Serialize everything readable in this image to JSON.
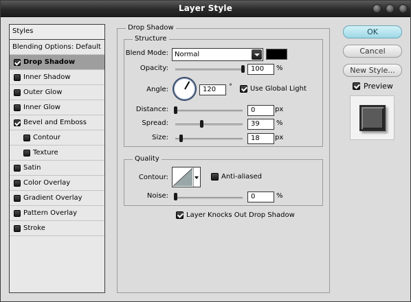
{
  "window": {
    "title": "Layer Style"
  },
  "styles_list": {
    "header": "Styles",
    "items": [
      {
        "label": "Blending Options: Default",
        "checkbox": false,
        "checked": false,
        "sub": false,
        "selected": false
      },
      {
        "label": "Drop Shadow",
        "checkbox": true,
        "checked": true,
        "sub": false,
        "selected": true
      },
      {
        "label": "Inner Shadow",
        "checkbox": true,
        "checked": false,
        "sub": false,
        "selected": false
      },
      {
        "label": "Outer Glow",
        "checkbox": true,
        "checked": false,
        "sub": false,
        "selected": false
      },
      {
        "label": "Inner Glow",
        "checkbox": true,
        "checked": false,
        "sub": false,
        "selected": false
      },
      {
        "label": "Bevel and Emboss",
        "checkbox": true,
        "checked": true,
        "sub": false,
        "selected": false
      },
      {
        "label": "Contour",
        "checkbox": true,
        "checked": false,
        "sub": true,
        "selected": false
      },
      {
        "label": "Texture",
        "checkbox": true,
        "checked": false,
        "sub": true,
        "selected": false
      },
      {
        "label": "Satin",
        "checkbox": true,
        "checked": false,
        "sub": false,
        "selected": false
      },
      {
        "label": "Color Overlay",
        "checkbox": true,
        "checked": false,
        "sub": false,
        "selected": false
      },
      {
        "label": "Gradient Overlay",
        "checkbox": true,
        "checked": false,
        "sub": false,
        "selected": false
      },
      {
        "label": "Pattern Overlay",
        "checkbox": true,
        "checked": false,
        "sub": false,
        "selected": false
      },
      {
        "label": "Stroke",
        "checkbox": true,
        "checked": false,
        "sub": false,
        "selected": false
      }
    ]
  },
  "drop_shadow": {
    "section_title": "Drop Shadow",
    "structure": {
      "title": "Structure",
      "blend_mode_label": "Blend Mode:",
      "blend_mode_value": "Normal",
      "shadow_color": "#000000",
      "opacity_label": "Opacity:",
      "opacity_value": "100",
      "opacity_fraction": 1.0,
      "opacity_unit": "%",
      "angle_label": "Angle:",
      "angle_value": "120",
      "angle_degrees": 120,
      "angle_unit": "°",
      "use_global_light_label": "Use Global Light",
      "use_global_light_checked": true,
      "distance_label": "Distance:",
      "distance_value": "0",
      "distance_fraction": 0.0,
      "distance_unit": "px",
      "spread_label": "Spread:",
      "spread_value": "39",
      "spread_fraction": 0.39,
      "spread_unit": "%",
      "size_label": "Size:",
      "size_value": "18",
      "size_fraction": 0.08,
      "size_unit": "px"
    },
    "quality": {
      "title": "Quality",
      "contour_label": "Contour:",
      "anti_aliased_label": "Anti-aliased",
      "anti_aliased_checked": false,
      "noise_label": "Noise:",
      "noise_value": "0",
      "noise_fraction": 0.0,
      "noise_unit": "%"
    },
    "knockout_label": "Layer Knocks Out Drop Shadow",
    "knockout_checked": true
  },
  "buttons": {
    "ok": "OK",
    "cancel": "Cancel",
    "new_style": "New Style...",
    "preview_label": "Preview",
    "preview_checked": true
  }
}
